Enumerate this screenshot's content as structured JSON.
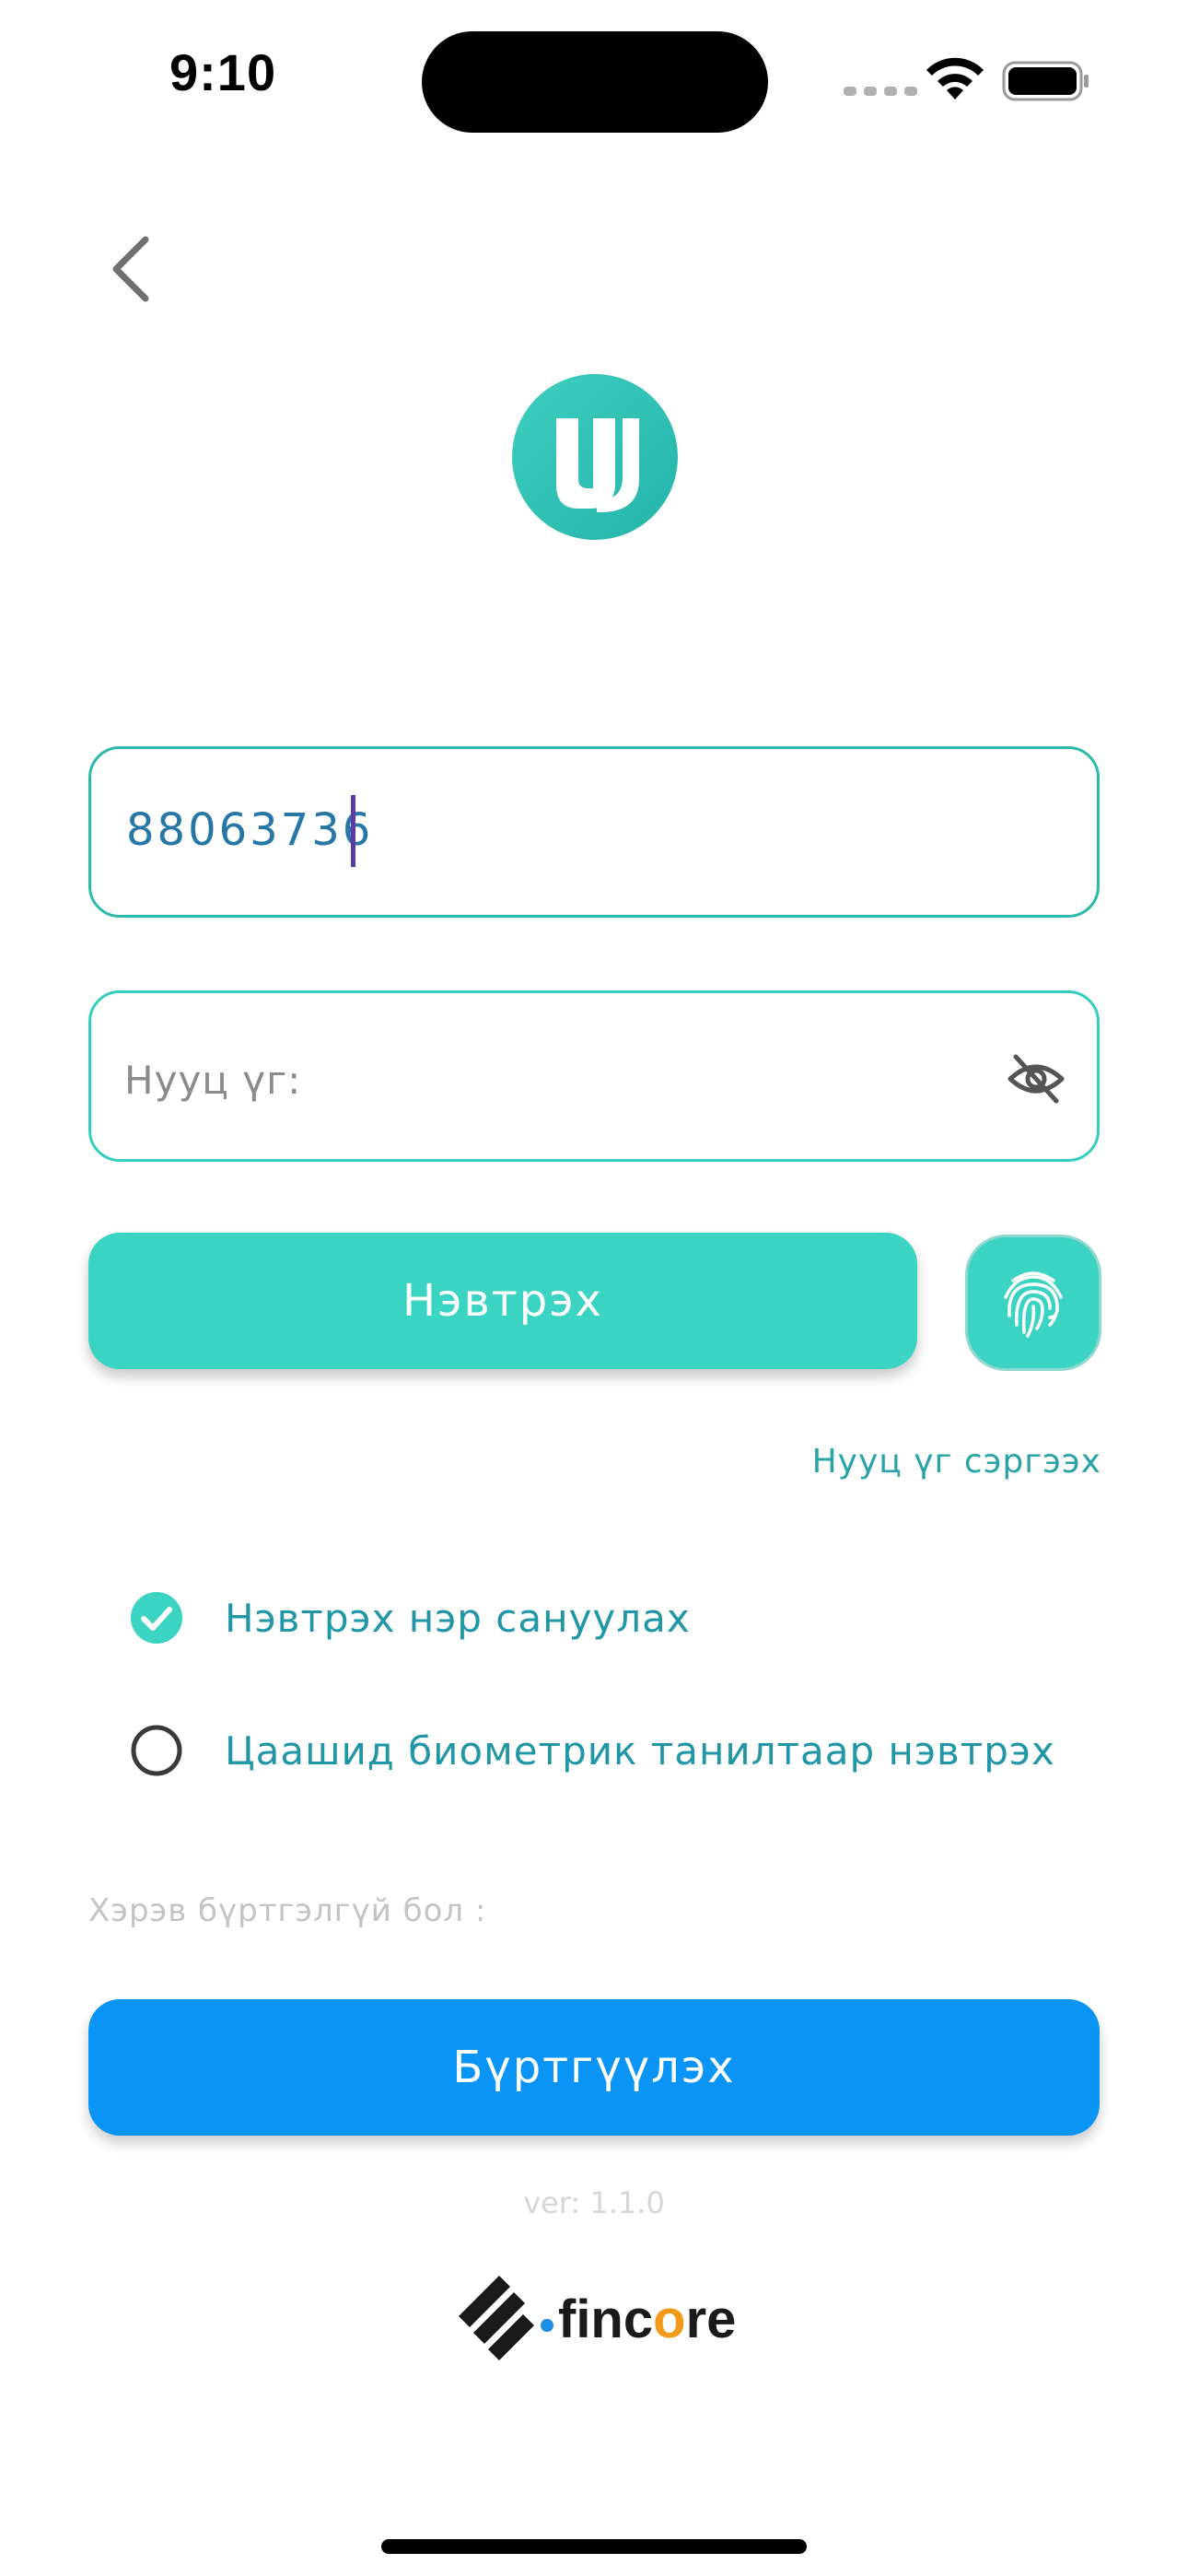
{
  "status_bar": {
    "time": "9:10"
  },
  "icons": {
    "back": "chevron-left-icon",
    "logo": "app-logo",
    "eye": "eye-off-icon",
    "fingerprint": "fingerprint-icon",
    "check_on": "check-circle-icon",
    "check_off": "circle-icon"
  },
  "login_form": {
    "phone_value": "88063736",
    "password_placeholder": "Нууц үг:",
    "login_label": "Нэвтрэх",
    "forgot_password": "Нууц үг сэргээх",
    "remember_username": {
      "label": "Нэвтрэх нэр сануулах",
      "checked": true
    },
    "biometric_login": {
      "label": "Цаашид биометрик танилтаар нэвтрэх",
      "checked": false
    }
  },
  "register": {
    "hint": "Хэрэв бүртгэлгүй бол :",
    "button_label": "Бүртгүүлэх"
  },
  "footer": {
    "version": "ver: 1.1.0",
    "brand_prefix": "finc",
    "brand_o": "o",
    "brand_suffix": "re"
  },
  "colors": {
    "teal": "#3bd3c2",
    "blue": "#0a94f6",
    "accent_text": "#2196a6",
    "brand_orange": "#f29a1a"
  }
}
